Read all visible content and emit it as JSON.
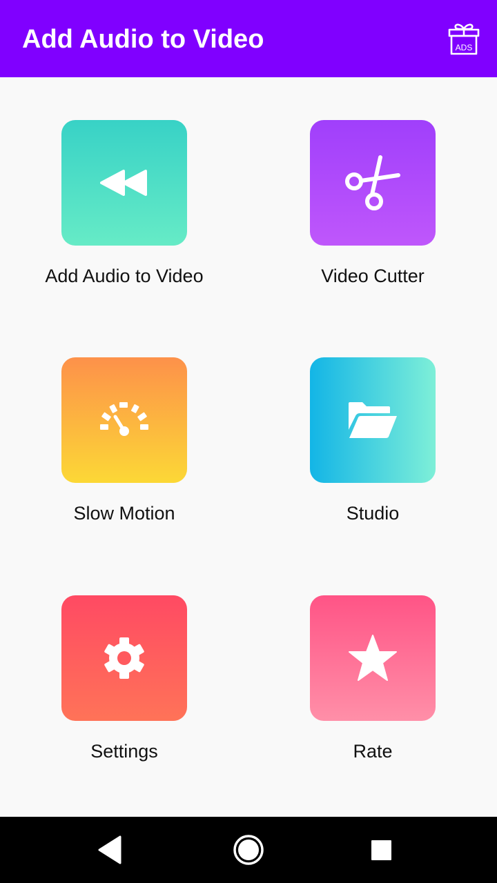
{
  "appbar": {
    "title": "Add Audio to Video",
    "ads_icon": "gift-ads-icon",
    "ads_text": "ADS",
    "background": "#8000ff"
  },
  "menu": {
    "items": [
      {
        "label": "Add Audio to Video",
        "icon": "rewind-icon",
        "colors": [
          "#38d2c6",
          "#66ebc6"
        ]
      },
      {
        "label": "Video Cutter",
        "icon": "scissors-icon",
        "colors": [
          "#a03ffb",
          "#bf57fb"
        ]
      },
      {
        "label": "Slow Motion",
        "icon": "speedometer-icon",
        "colors": [
          "#fd914a",
          "#fcd836"
        ]
      },
      {
        "label": "Studio",
        "icon": "folder-open-icon",
        "colors": [
          "#13b5e6",
          "#7eefd8"
        ]
      },
      {
        "label": "Settings",
        "icon": "gear-icon",
        "colors": [
          "#ff4a63",
          "#ff7358"
        ]
      },
      {
        "label": "Rate",
        "icon": "star-icon",
        "colors": [
          "#ff5486",
          "#ff8fa8"
        ]
      }
    ]
  },
  "navbar": {
    "back_icon": "back-triangle-icon",
    "home_icon": "home-circle-icon",
    "recents_icon": "recents-square-icon"
  }
}
